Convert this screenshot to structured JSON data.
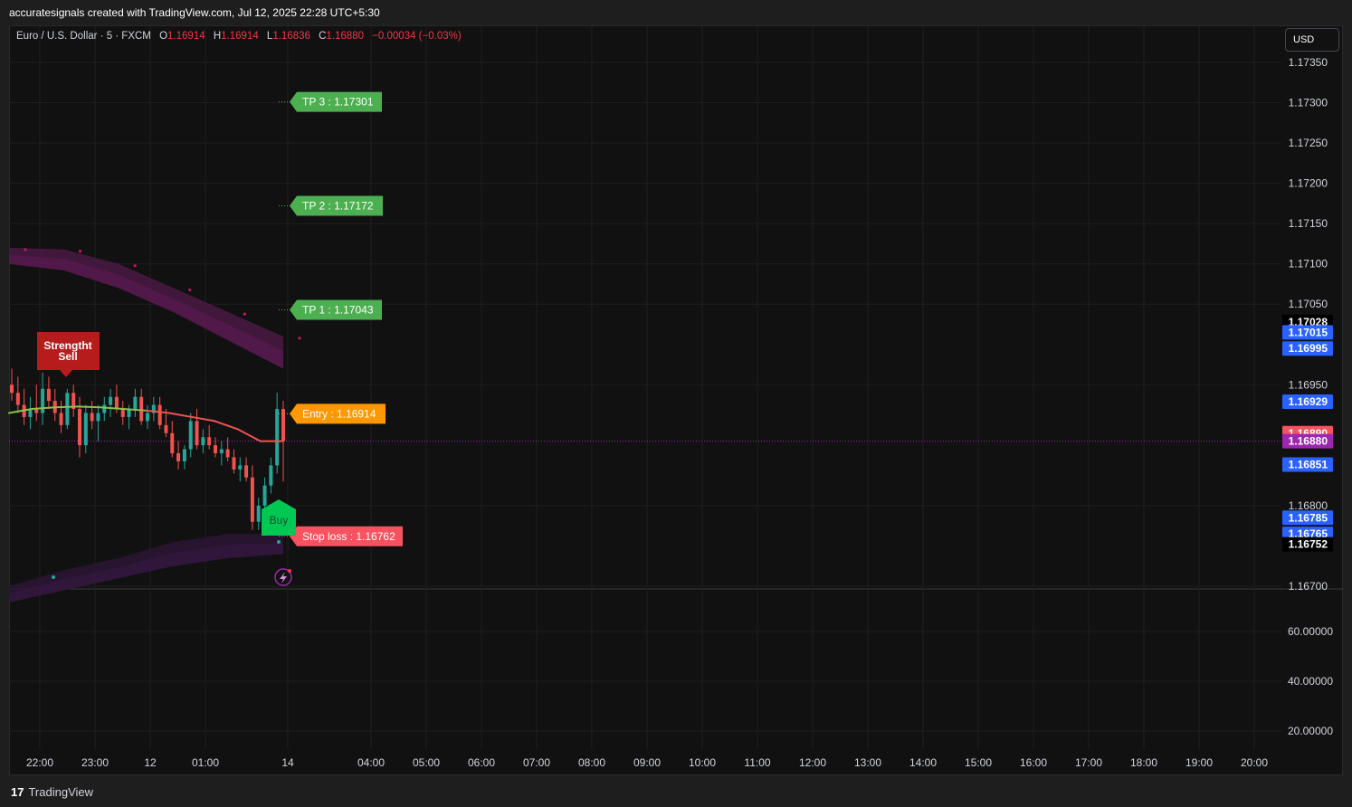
{
  "header": {
    "title": "accuratesignals created with TradingView.com, Jul 12, 2025 22:28 UTC+5:30"
  },
  "legend": {
    "symbol": "Euro / U.S. Dollar · 5 · FXCM",
    "open_label": "O",
    "open": "1.16914",
    "high_label": "H",
    "high": "1.16914",
    "low_label": "L",
    "low": "1.16836",
    "close_label": "C",
    "close": "1.16880",
    "change": "−0.00034 (−0.03%)"
  },
  "currency_button": "USD",
  "price_axis": {
    "ticks": [
      "1.17350",
      "1.17300",
      "1.17250",
      "1.17200",
      "1.17150",
      "1.17100",
      "1.17050",
      "1.16950",
      "1.16800",
      "1.16700"
    ],
    "tick_values": [
      1.1735,
      1.173,
      1.1725,
      1.172,
      1.1715,
      1.171,
      1.1705,
      1.1695,
      1.168,
      1.167
    ],
    "badges": [
      {
        "label": "1.17028",
        "value": 1.17028,
        "color": "#000000"
      },
      {
        "label": "1.17015",
        "value": 1.17015,
        "color": "#2962ff"
      },
      {
        "label": "1.16995",
        "value": 1.16995,
        "color": "#2962ff"
      },
      {
        "label": "1.16929",
        "value": 1.16929,
        "color": "#2962ff"
      },
      {
        "label": "1.16890",
        "value": 1.1689,
        "color": "#f7525f"
      },
      {
        "label": "1.16880",
        "value": 1.1688,
        "color": "#9c27b0"
      },
      {
        "label": "1.16851",
        "value": 1.16851,
        "color": "#2962ff"
      },
      {
        "label": "1.16785",
        "value": 1.16785,
        "color": "#2962ff"
      },
      {
        "label": "1.16765",
        "value": 1.16765,
        "color": "#2962ff"
      },
      {
        "label": "1.16752",
        "value": 1.16752,
        "color": "#000000"
      }
    ]
  },
  "indicator_axis": {
    "ticks": [
      "60.00000",
      "40.00000",
      "20.00000"
    ],
    "tick_values": [
      60,
      40,
      20
    ]
  },
  "time_axis": {
    "labels": [
      "22:00",
      "23:00",
      "12",
      "01:00",
      "14",
      "04:00",
      "05:00",
      "06:00",
      "07:00",
      "08:00",
      "09:00",
      "10:00",
      "11:00",
      "12:00",
      "13:00",
      "14:00",
      "15:00",
      "16:00",
      "17:00",
      "18:00",
      "19:00",
      "20:00"
    ]
  },
  "signals": {
    "tp3": {
      "label": "TP 3 : 1.17301",
      "value": 1.17301,
      "color": "#4caf50"
    },
    "tp2": {
      "label": "TP 2 : 1.17172",
      "value": 1.17172,
      "color": "#4caf50"
    },
    "tp1": {
      "label": "TP 1 : 1.17043",
      "value": 1.17043,
      "color": "#4caf50"
    },
    "entry": {
      "label": "Entry : 1.16914",
      "value": 1.16914,
      "color": "#ff9800"
    },
    "stop": {
      "label": "Stop loss : 1.16762",
      "value": 1.16762,
      "color": "#f7525f"
    },
    "buy": {
      "label": "Buy",
      "color": "#00c853"
    },
    "sell": {
      "line1": "Strengtht",
      "line2": "Sell",
      "color": "#b71c1c"
    }
  },
  "current_price_line": {
    "value": 1.1688,
    "color": "#9c27b0"
  },
  "chart_data": {
    "type": "candlestick",
    "symbol": "Euro / U.S. Dollar",
    "interval": "5",
    "candles": [
      {
        "o": 1.1695,
        "h": 1.1697,
        "l": 1.1693,
        "c": 1.1694
      },
      {
        "o": 1.1694,
        "h": 1.1696,
        "l": 1.16915,
        "c": 1.16925
      },
      {
        "o": 1.16925,
        "h": 1.16945,
        "l": 1.169,
        "c": 1.1691
      },
      {
        "o": 1.1691,
        "h": 1.16935,
        "l": 1.16895,
        "c": 1.1692
      },
      {
        "o": 1.1692,
        "h": 1.1695,
        "l": 1.16905,
        "c": 1.16915
      },
      {
        "o": 1.16915,
        "h": 1.16965,
        "l": 1.169,
        "c": 1.16945
      },
      {
        "o": 1.16945,
        "h": 1.1696,
        "l": 1.1692,
        "c": 1.1693
      },
      {
        "o": 1.1693,
        "h": 1.16945,
        "l": 1.16905,
        "c": 1.16915
      },
      {
        "o": 1.16915,
        "h": 1.1693,
        "l": 1.1689,
        "c": 1.169
      },
      {
        "o": 1.169,
        "h": 1.16945,
        "l": 1.16895,
        "c": 1.1694
      },
      {
        "o": 1.1694,
        "h": 1.1695,
        "l": 1.1691,
        "c": 1.1692
      },
      {
        "o": 1.1692,
        "h": 1.16935,
        "l": 1.1686,
        "c": 1.16875
      },
      {
        "o": 1.16875,
        "h": 1.16925,
        "l": 1.16865,
        "c": 1.16915
      },
      {
        "o": 1.16915,
        "h": 1.1693,
        "l": 1.16895,
        "c": 1.16905
      },
      {
        "o": 1.16905,
        "h": 1.16925,
        "l": 1.1688,
        "c": 1.16915
      },
      {
        "o": 1.16915,
        "h": 1.16935,
        "l": 1.16905,
        "c": 1.16925
      },
      {
        "o": 1.16925,
        "h": 1.16945,
        "l": 1.1691,
        "c": 1.16935
      },
      {
        "o": 1.16935,
        "h": 1.1695,
        "l": 1.16915,
        "c": 1.1692
      },
      {
        "o": 1.1692,
        "h": 1.1693,
        "l": 1.169,
        "c": 1.1691
      },
      {
        "o": 1.1691,
        "h": 1.16925,
        "l": 1.16895,
        "c": 1.1692
      },
      {
        "o": 1.1692,
        "h": 1.16945,
        "l": 1.1691,
        "c": 1.16935
      },
      {
        "o": 1.16935,
        "h": 1.16945,
        "l": 1.169,
        "c": 1.16905
      },
      {
        "o": 1.16905,
        "h": 1.16925,
        "l": 1.16895,
        "c": 1.16915
      },
      {
        "o": 1.16915,
        "h": 1.16935,
        "l": 1.16905,
        "c": 1.16925
      },
      {
        "o": 1.16925,
        "h": 1.16935,
        "l": 1.16895,
        "c": 1.169
      },
      {
        "o": 1.169,
        "h": 1.1692,
        "l": 1.16885,
        "c": 1.1689
      },
      {
        "o": 1.1689,
        "h": 1.16905,
        "l": 1.1686,
        "c": 1.16865
      },
      {
        "o": 1.16865,
        "h": 1.1688,
        "l": 1.16845,
        "c": 1.16855
      },
      {
        "o": 1.16855,
        "h": 1.16875,
        "l": 1.16845,
        "c": 1.1687
      },
      {
        "o": 1.1687,
        "h": 1.16915,
        "l": 1.1686,
        "c": 1.16905
      },
      {
        "o": 1.16905,
        "h": 1.1692,
        "l": 1.1687,
        "c": 1.16875
      },
      {
        "o": 1.16875,
        "h": 1.16895,
        "l": 1.16865,
        "c": 1.16885
      },
      {
        "o": 1.16885,
        "h": 1.169,
        "l": 1.1687,
        "c": 1.16875
      },
      {
        "o": 1.16875,
        "h": 1.16885,
        "l": 1.1686,
        "c": 1.16865
      },
      {
        "o": 1.16865,
        "h": 1.1688,
        "l": 1.1685,
        "c": 1.1687
      },
      {
        "o": 1.1687,
        "h": 1.16885,
        "l": 1.16855,
        "c": 1.1686
      },
      {
        "o": 1.1686,
        "h": 1.1687,
        "l": 1.1684,
        "c": 1.16845
      },
      {
        "o": 1.16845,
        "h": 1.1686,
        "l": 1.1683,
        "c": 1.1685
      },
      {
        "o": 1.1685,
        "h": 1.1686,
        "l": 1.1683,
        "c": 1.16835
      },
      {
        "o": 1.16835,
        "h": 1.1685,
        "l": 1.1677,
        "c": 1.1678
      },
      {
        "o": 1.1678,
        "h": 1.1681,
        "l": 1.1677,
        "c": 1.168
      },
      {
        "o": 1.168,
        "h": 1.16835,
        "l": 1.1679,
        "c": 1.16825
      },
      {
        "o": 1.16825,
        "h": 1.1686,
        "l": 1.16815,
        "c": 1.1685
      },
      {
        "o": 1.1685,
        "h": 1.1694,
        "l": 1.1684,
        "c": 1.1692
      },
      {
        "o": 1.1692,
        "h": 1.1693,
        "l": 1.1683,
        "c": 1.1688
      }
    ],
    "moving_average": [
      1.16915,
      1.1692,
      1.16922,
      1.16923,
      1.16922,
      1.1692,
      1.16918,
      1.16915,
      1.1691,
      1.16905,
      1.16895,
      1.1688,
      1.1688
    ],
    "upper_band": {
      "top": [
        1.1712,
        1.17118,
        1.171,
        1.1707,
        1.1704,
        1.1701
      ],
      "bottom": [
        1.171,
        1.17092,
        1.1707,
        1.1704,
        1.17005,
        1.1697
      ]
    },
    "lower_band": {
      "top": [
        1.167,
        1.1672,
        1.16735,
        1.16755,
        1.16765,
        1.16765
      ],
      "bottom": [
        1.1668,
        1.16695,
        1.1671,
        1.16725,
        1.16735,
        1.1674
      ]
    },
    "y_range": [
      1.1669,
      1.1738
    ],
    "grid": true
  }
}
